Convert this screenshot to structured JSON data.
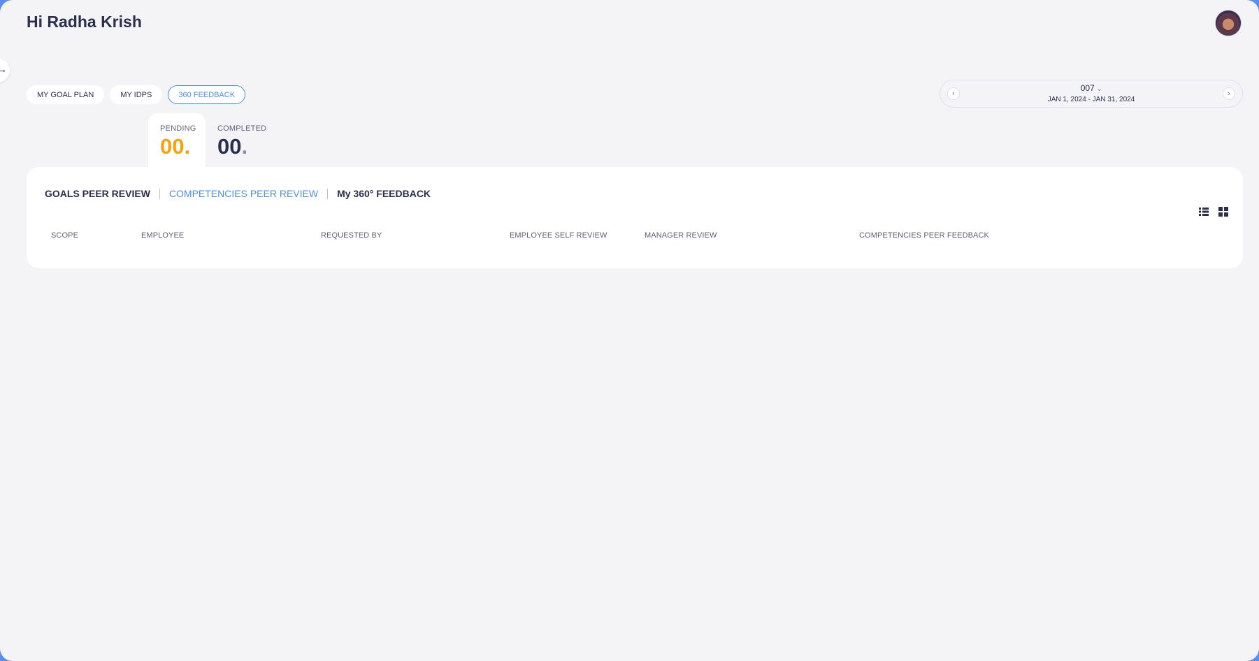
{
  "header": {
    "greeting": "Hi Radha Krish"
  },
  "top_tabs": [
    {
      "label": "MY GOAL PLAN",
      "active": false
    },
    {
      "label": "MY IDPS",
      "active": false
    },
    {
      "label": "360 FEEDBACK",
      "active": true
    }
  ],
  "period": {
    "cycle": "007",
    "range": "JAN 1, 2024 - JAN 31, 2024"
  },
  "status": {
    "pending": {
      "label": "PENDING",
      "count": "00"
    },
    "completed": {
      "label": "COMPLETED",
      "count": "00"
    }
  },
  "sub_tabs": [
    {
      "label": "GOALS PEER REVIEW",
      "active": false
    },
    {
      "label": "COMPETENCIES PEER REVIEW",
      "active": true
    },
    {
      "label": "My 360° FEEDBACK",
      "active": false
    }
  ],
  "table": {
    "columns": [
      "SCOPE",
      "EMPLOYEE",
      "REQUESTED BY",
      "EMPLOYEE SELF REVIEW",
      "MANAGER REVIEW",
      "COMPETENCIES PEER FEEDBACK"
    ],
    "rows": []
  },
  "colors": {
    "accent": "#4a90e2",
    "pending": "#f5a114",
    "text": "#292f4c",
    "background": "#f4f4f7"
  },
  "icons": {
    "sidebar_toggle": "arrow-right-icon",
    "avatar": "user-avatar",
    "prev": "chevron-left-icon",
    "next": "chevron-right-icon",
    "list_view": "list-view-icon",
    "grid_view": "grid-view-icon"
  }
}
